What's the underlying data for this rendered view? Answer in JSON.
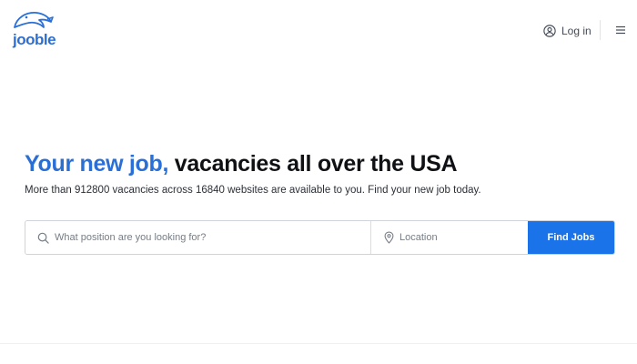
{
  "brand": {
    "logo_text": "jooble",
    "logo_icon": "jooble-logo-icon",
    "accent_color": "#2a6fd6"
  },
  "header": {
    "login_label": "Log in",
    "login_icon": "user-circle-icon",
    "menu_icon": "hamburger-menu-icon"
  },
  "hero": {
    "title_accent": "Your new job,",
    "title_rest": " vacancies all over the USA",
    "subtitle": "More than 912800 vacancies across 16840 websites are available to you. Find your new job today."
  },
  "search": {
    "position_placeholder": "What position are you looking for?",
    "position_value": "",
    "position_icon": "search-icon",
    "location_placeholder": "Location",
    "location_value": "",
    "location_icon": "location-pin-icon",
    "submit_label": "Find Jobs",
    "submit_color": "#1a73e8"
  }
}
